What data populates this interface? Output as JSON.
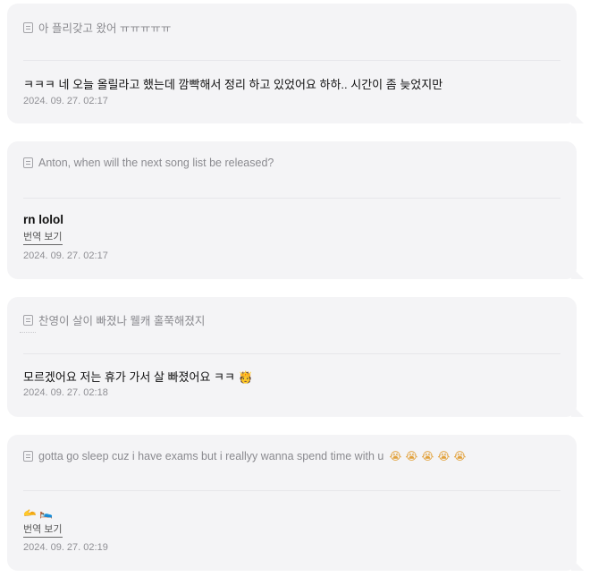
{
  "cards": [
    {
      "question": "아 플리갖고 왔어 ㅠㅠㅠㅠㅠ",
      "answer": "ㅋㅋㅋ 네 오늘 올릴라고 했는데 깜빡해서 정리 하고 있었어요 하하.. 시간이 좀 늦었지만",
      "timestamp": "2024. 09. 27. 02:17"
    },
    {
      "question": "Anton, when will the next song list be released?",
      "answer": "rn lolol",
      "translate_label": "번역 보기",
      "timestamp": "2024. 09. 27. 02:17"
    },
    {
      "question": "찬영이 살이 빠졌나 웰캐 홀쭉해졌지",
      "answer": "모르겠어요 저는 휴가 가서 살 빠졌어요 ㅋㅋ 🫅",
      "timestamp": "2024. 09. 27. 02:18"
    },
    {
      "question": "gotta go sleep cuz i have exams but i reallyy wanna spend time with u",
      "question_emojis": "😭😭😭😭😭",
      "answer": "🫴 🛌",
      "translate_label": "번역 보기",
      "timestamp": "2024. 09. 27. 02:19"
    }
  ],
  "colors": {
    "card_bg": "#f4f4f6",
    "question_text": "#8a8a8f",
    "answer_text": "#111111",
    "timestamp_text": "#8f8f94"
  },
  "icons": [
    "question-icon"
  ]
}
